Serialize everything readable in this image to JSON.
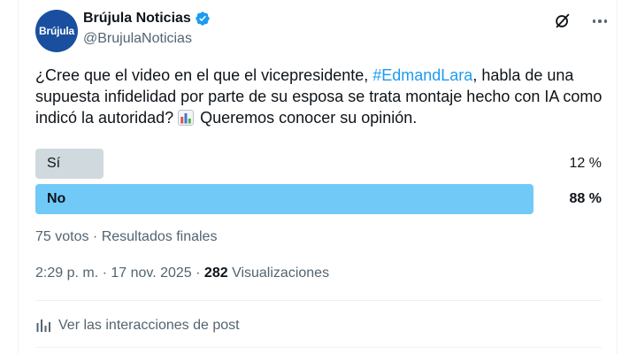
{
  "author": {
    "avatar_text": "Brújula",
    "name": "Brújula Noticias",
    "handle": "@BrujulaNoticias",
    "verified": true
  },
  "header_icons": {
    "grok": "grok-icon",
    "more": "more-icon"
  },
  "post": {
    "text_before": "¿Cree que el video en el que el vicepresidente, ",
    "hashtag": "#EdmandLara",
    "text_after": ", habla de una supuesta infidelidad por parte de su esposa se trata montaje hecho con IA como indicó la autoridad? ",
    "emoji": "bar-chart-emoji",
    "text_end": " Queremos conocer su opinión."
  },
  "poll": {
    "options": [
      {
        "label": "Sí",
        "percent_label": "12 %",
        "percent": 12,
        "winner": false
      },
      {
        "label": "No",
        "percent_label": "88 %",
        "percent": 88,
        "winner": true
      }
    ],
    "meta": "75 votos · Resultados finales"
  },
  "timestamp": {
    "time_date": "2:29 p. m. · 17 nov. 2025 · ",
    "views_count": "282",
    "views_label": " Visualizaciones"
  },
  "interactions": {
    "label": "Ver las interacciones de post"
  },
  "colors": {
    "accent": "#1d9bf0",
    "winner_bar": "#71c9f8",
    "loser_bar": "#cfd9de",
    "secondary_text": "#536471"
  }
}
